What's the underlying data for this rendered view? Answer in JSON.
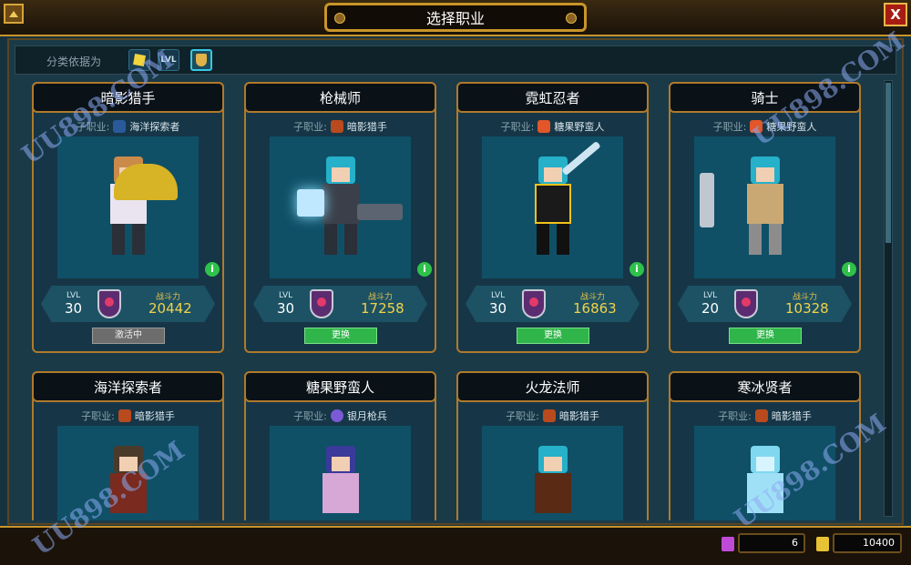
{
  "window": {
    "title": "选择职业",
    "close_label": "X"
  },
  "filter": {
    "label": "分类依据为",
    "options": [
      "cube-icon",
      "LVL",
      "rank-icon"
    ],
    "lvl_label": "LVL"
  },
  "cards": [
    {
      "name": "暗影猎手",
      "sub_label": "子职业:",
      "sub_value": "海洋探索者",
      "lvl_label": "LVL",
      "level": "30",
      "power_label": "战斗力",
      "power": "20442",
      "button": "激活中",
      "state": "active"
    },
    {
      "name": "枪械师",
      "sub_label": "子职业:",
      "sub_value": "暗影猎手",
      "lvl_label": "LVL",
      "level": "30",
      "power_label": "战斗力",
      "power": "17258",
      "button": "更换",
      "state": "change"
    },
    {
      "name": "霓虹忍者",
      "sub_label": "子职业:",
      "sub_value": "糖果野蛮人",
      "lvl_label": "LVL",
      "level": "30",
      "power_label": "战斗力",
      "power": "16863",
      "button": "更换",
      "state": "change"
    },
    {
      "name": "骑士",
      "sub_label": "子职业:",
      "sub_value": "糖果野蛮人",
      "lvl_label": "LVL",
      "level": "20",
      "power_label": "战斗力",
      "power": "10328",
      "button": "更换",
      "state": "change"
    },
    {
      "name": "海洋探索者",
      "sub_label": "子职业:",
      "sub_value": "暗影猎手"
    },
    {
      "name": "糖果野蛮人",
      "sub_label": "子职业:",
      "sub_value": "银月枪兵"
    },
    {
      "name": "火龙法师",
      "sub_label": "子职业:",
      "sub_value": "暗影猎手"
    },
    {
      "name": "寒冰贤者",
      "sub_label": "子职业:",
      "sub_value": "暗影猎手"
    }
  ],
  "info_label": "i",
  "currency": {
    "cubits": "6",
    "coins": "10400"
  },
  "watermark": "UU898.COM"
}
